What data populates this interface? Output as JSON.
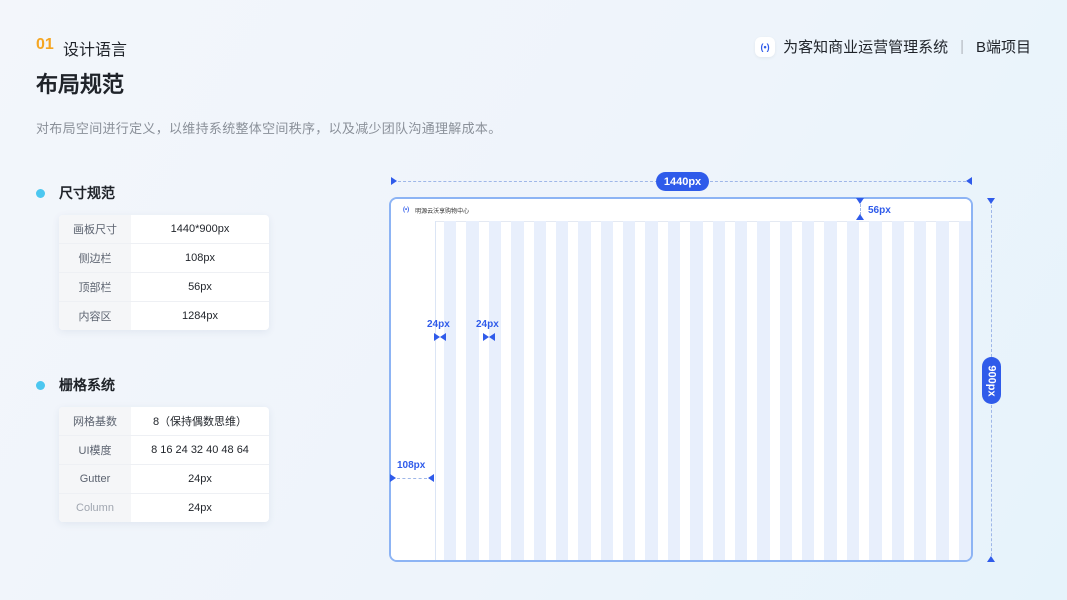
{
  "header": {
    "section_number": "01",
    "section_title": "设计语言",
    "page_title": "布局规范",
    "description": "对布局空间进行定义，以维持系统整体空间秩序，以及减少团队沟通理解成本。"
  },
  "brand": {
    "logo_text": "(•)",
    "name": "为客知商业运营管理系统",
    "divider": "|",
    "tag": "B端项目"
  },
  "size_spec": {
    "heading": "尺寸规范",
    "rows": [
      {
        "key": "画板尺寸",
        "value": "1440*900px"
      },
      {
        "key": "侧边栏",
        "value": "108px"
      },
      {
        "key": "顶部栏",
        "value": "56px"
      },
      {
        "key": "内容区",
        "value": "1284px"
      }
    ]
  },
  "grid_spec": {
    "heading": "栅格系统",
    "rows": [
      {
        "key": "网格基数",
        "value": "8（保持偶数思维）"
      },
      {
        "key": "UI模度",
        "value": "8 16 24 32 40 48 64"
      },
      {
        "key": "Gutter",
        "value": "24px"
      },
      {
        "key": "Column",
        "value": "24px"
      }
    ]
  },
  "diagram": {
    "width_label": "1440px",
    "height_label": "900px",
    "topbar_height_label": "56px",
    "sidebar_width_label": "108px",
    "gutter_label_1": "24px",
    "gutter_label_2": "24px",
    "topbar_logo": "(•)",
    "topbar_title": "明源云沃享购物中心",
    "column_count": 24
  },
  "colors": {
    "accent": "#2f5bea",
    "section_number": "#f5a623",
    "bullet": "#4cc7f0",
    "frame_border": "#8db4f4",
    "grid_column": "#e8effc"
  }
}
